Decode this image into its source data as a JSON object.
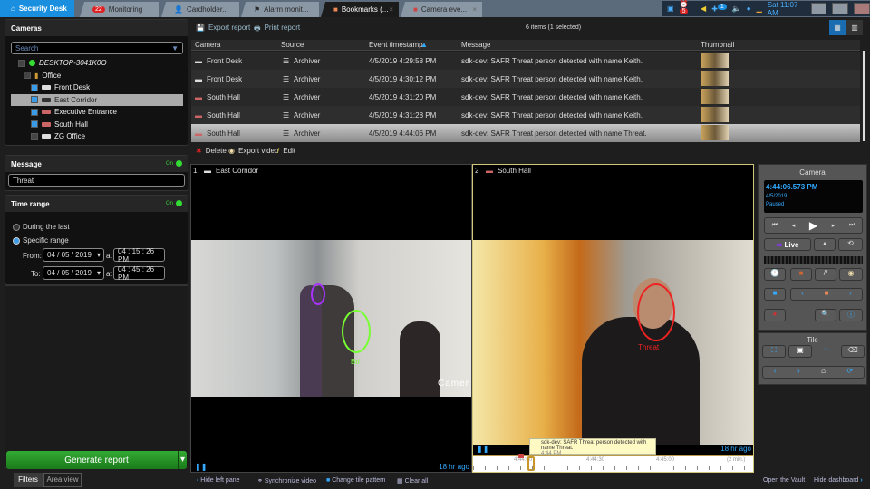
{
  "tabs": {
    "home": "Security Desk",
    "items": [
      {
        "label": "Monitoring",
        "badge": "22"
      },
      {
        "label": "Cardholder..."
      },
      {
        "label": "Alarm monit..."
      },
      {
        "label": "Bookmarks (..."
      },
      {
        "label": "Camera eve..."
      }
    ]
  },
  "tray": {
    "alarm_badge": "5",
    "task_badge": "1",
    "clock": "Sat 11:07 AM"
  },
  "filters": {
    "cameras_title": "Cameras",
    "search_placeholder": "Search",
    "tree": [
      {
        "label": "DESKTOP-3041K0O",
        "checked": false
      },
      {
        "label": "Office",
        "checked": false
      },
      {
        "label": "Front Desk",
        "checked": true
      },
      {
        "label": "East Corridor",
        "checked": true
      },
      {
        "label": "Executive Entrance",
        "checked": true
      },
      {
        "label": "South Hall",
        "checked": true
      },
      {
        "label": "ZG Office",
        "checked": false
      }
    ],
    "message_title": "Message",
    "message_on": "On",
    "message_value": "Threat",
    "time_title": "Time range",
    "time_on": "On",
    "during_last": "During the last",
    "specific_range": "Specific range",
    "from_label": "From:",
    "to_label": "To:",
    "at": "at",
    "from_date": "04 / 05 / 2019",
    "from_time": "04 : 15 : 26 PM",
    "to_date": "04 / 05 / 2019",
    "to_time": "04 : 45 : 26 PM",
    "generate": "Generate report",
    "tab_filters": "Filters",
    "tab_area": "Area view"
  },
  "toolbar": {
    "export": "Export report",
    "print": "Print report",
    "count": "6 items (1 selected)"
  },
  "table": {
    "headers": [
      "Camera",
      "Source",
      "Event timestamp",
      "Message",
      "Thumbnail"
    ],
    "rows": [
      [
        "Front Desk",
        "Archiver",
        "4/5/2019 4:29:58 PM",
        "sdk-dev: SAFR Threat person detected with name Keith."
      ],
      [
        "Front Desk",
        "Archiver",
        "4/5/2019 4:30:12 PM",
        "sdk-dev: SAFR Threat person detected with name Keith."
      ],
      [
        "South Hall",
        "Archiver",
        "4/5/2019 4:31:20 PM",
        "sdk-dev: SAFR Threat person detected with name Keith."
      ],
      [
        "South Hall",
        "Archiver",
        "4/5/2019 4:31:28 PM",
        "sdk-dev: SAFR Threat person detected with name Keith."
      ],
      [
        "South Hall",
        "Archiver",
        "4/5/2019 4:44:06 PM",
        "sdk-dev: SAFR Threat person detected with name Threat."
      ]
    ]
  },
  "actions": {
    "delete": "Delete",
    "export_video": "Export video",
    "edit": "Edit"
  },
  "tiles": [
    {
      "num": "1",
      "name": "East Corridor",
      "ago": "18 hr ago",
      "face_label": "Bri",
      "overlay": "Camer"
    },
    {
      "num": "2",
      "name": "South Hall",
      "ago": "18 hr ago",
      "face_label": "Threat"
    }
  ],
  "timeline": {
    "tooltip": "sdk-dev: SAFR Threat person detected with name Threat.",
    "tooltip_time": "4:44 PM",
    "ticks": [
      "4:44:00",
      "4:44:30",
      "4:45:00",
      "(2 min.)"
    ]
  },
  "dashboard": {
    "camera_title": "Camera",
    "time": "4:44:06.573 PM",
    "date": "4/5/2019",
    "state": "Paused",
    "live": "Live",
    "tile_title": "Tile"
  },
  "bottom": {
    "hide_left": "Hide left pane",
    "sync": "Synchronize video",
    "pattern": "Change tile pattern",
    "clear": "Clear all",
    "vault": "Open the Vault",
    "hide_dash": "Hide dashboard"
  }
}
